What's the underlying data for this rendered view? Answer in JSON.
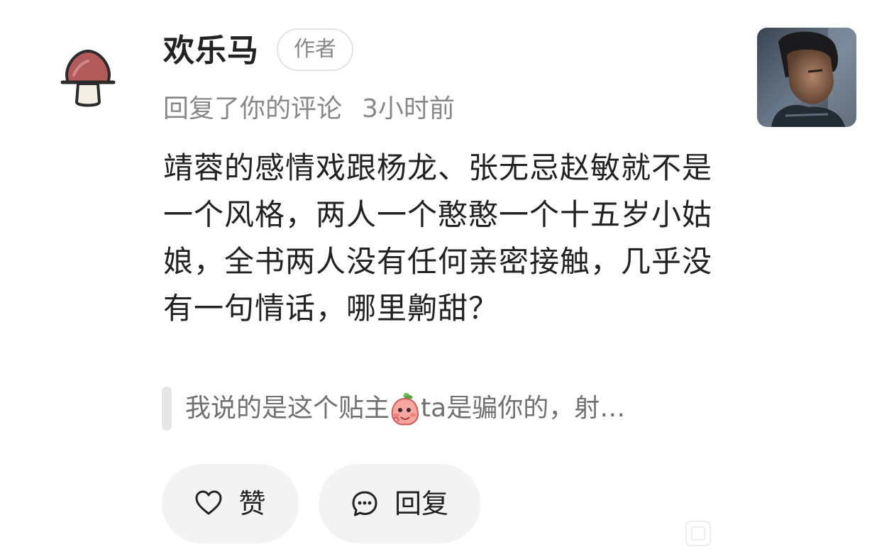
{
  "comment": {
    "username": "欢乐马",
    "author_badge": "作者",
    "action": "回复了你的评论",
    "time": "3小时前",
    "content": "靖蓉的感情戏跟杨龙、张无忌赵敏就不是一个风格，两人一个憨憨一个十五岁小姑娘，全书两人没有任何亲密接触，几乎没有一句情话，哪里齁甜？",
    "quote_prefix": "我说的是这个贴主",
    "quote_suffix": "ta是骗你的，射…"
  },
  "actions": {
    "like_label": "赞",
    "reply_label": "回复"
  },
  "icons": {
    "avatar": "mushroom-avatar",
    "emoji": "peach-emoji",
    "like": "heart-icon",
    "reply": "chat-bubble-icon",
    "watermark": "watermark-icon"
  },
  "colors": {
    "mushroom_cap": "#b25a5a",
    "meta_text": "#888888",
    "button_bg": "#f3f3f3"
  }
}
